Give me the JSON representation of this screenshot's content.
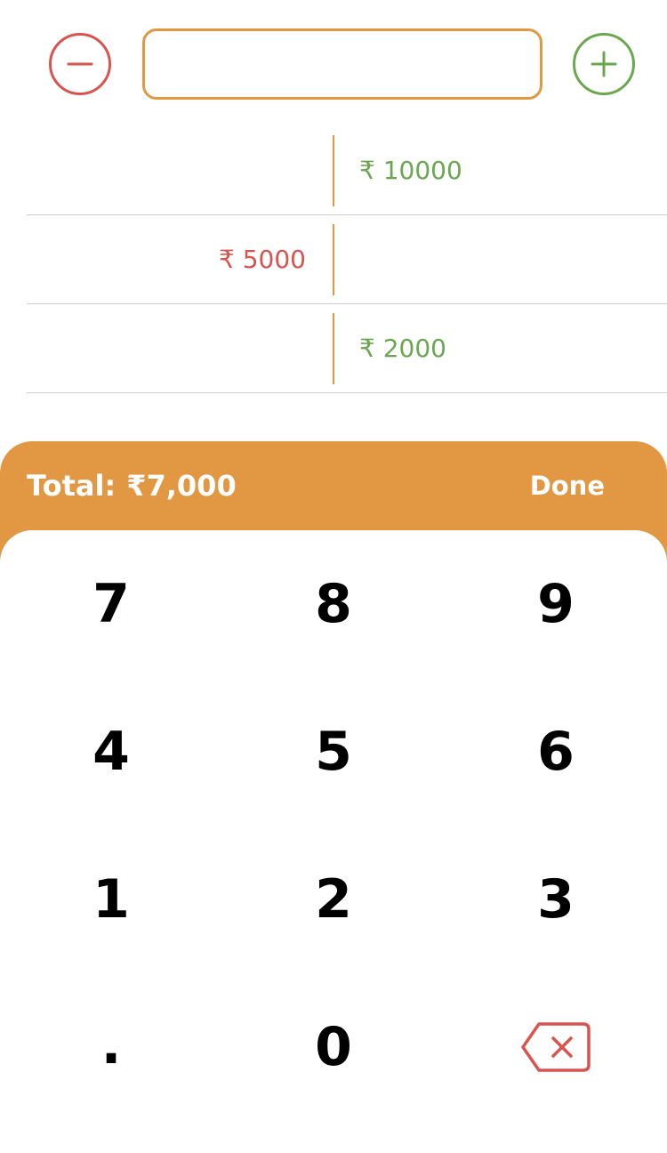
{
  "input": {
    "value": "",
    "placeholder": ""
  },
  "colors": {
    "accent": "#e29843",
    "debit": "#d9534f",
    "credit": "#6aa84f",
    "row_divider": "#cfcfcf"
  },
  "icons": {
    "minus": "minus-circle-icon",
    "plus": "plus-circle-icon",
    "backspace": "backspace-icon"
  },
  "entries": [
    {
      "debit": "",
      "credit": "₹ 10000"
    },
    {
      "debit": "₹ 5000",
      "credit": ""
    },
    {
      "debit": "",
      "credit": "₹ 2000"
    }
  ],
  "summary": {
    "total_label": "Total:",
    "total_value": "₹7,000",
    "done_label": "Done"
  },
  "keypad": {
    "rows": [
      [
        "7",
        "8",
        "9"
      ],
      [
        "4",
        "5",
        "6"
      ],
      [
        "1",
        "2",
        "3"
      ],
      [
        ".",
        "0",
        ""
      ]
    ]
  }
}
